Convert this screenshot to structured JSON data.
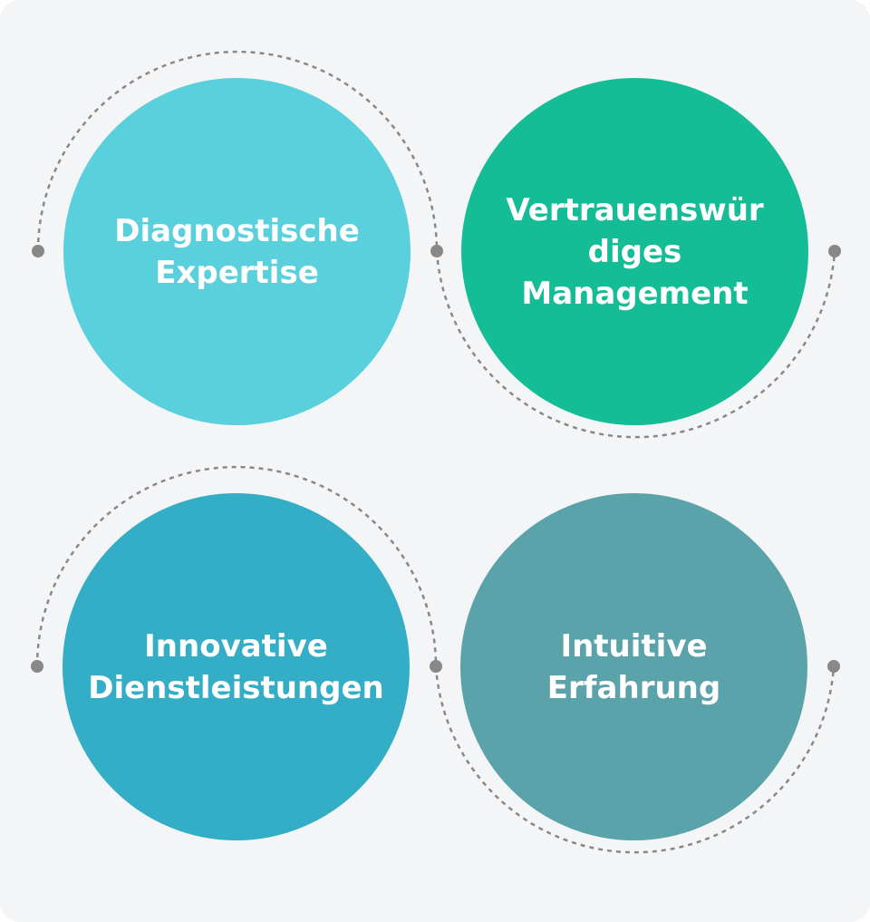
{
  "colors": {
    "background": "#f4f5f7",
    "connector": "#888888",
    "label": "#ffffff"
  },
  "nodes": [
    {
      "label": "Diagnostische\nExpertise",
      "color": "#5bd0dd"
    },
    {
      "label": "Vertrauenswür\ndiges\nManagement",
      "color": "#14bd96"
    },
    {
      "label": "Innovative\nDienstleistungen",
      "color": "#33aec6"
    },
    {
      "label": "Intuitive\nErfahrung",
      "color": "#5ba3aa"
    }
  ]
}
